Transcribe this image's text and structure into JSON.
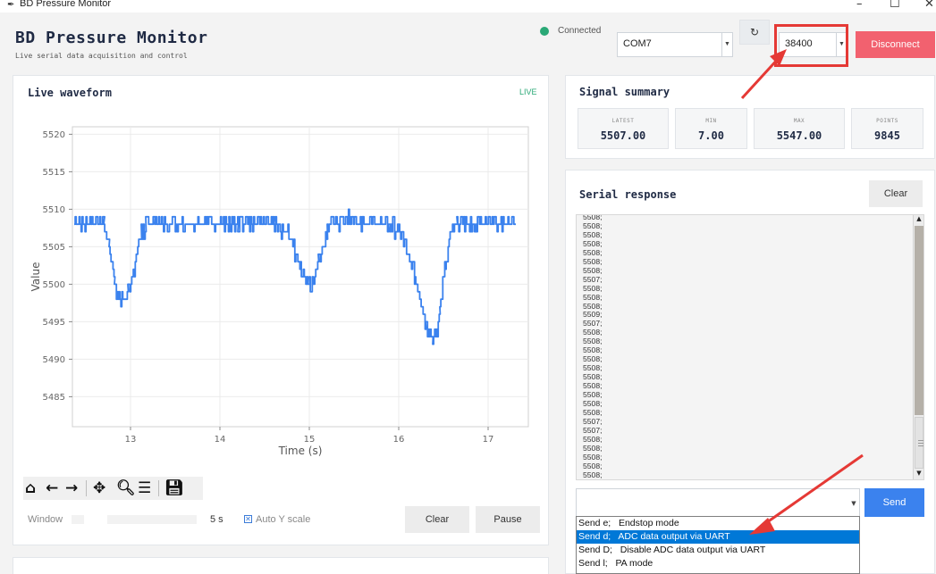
{
  "window": {
    "title": "BD Pressure Monitor",
    "controls": [
      "–",
      "☐",
      "✕"
    ]
  },
  "header": {
    "title": "BD Pressure Monitor",
    "subtitle": "Live serial data acquisition and control",
    "status": "Connected",
    "status_color": "#2aa876",
    "port": "COM7",
    "baud": "38400",
    "refresh_icon": "refresh-icon",
    "disconnect_label": "Disconnect"
  },
  "waveform": {
    "title": "Live waveform",
    "badge": "LIVE",
    "window_label": "Window",
    "window_value": "5 s",
    "auto_y_label": "Auto Y scale",
    "auto_y_checked": true,
    "clear_label": "Clear",
    "pause_label": "Pause",
    "toolbar_icons": [
      "home-icon",
      "back-arrow-icon",
      "forward-arrow-icon",
      "pan-icon",
      "zoom-icon",
      "configure-icon",
      "save-icon"
    ]
  },
  "chart_data": {
    "type": "line",
    "title": "",
    "xlabel": "Time (s)",
    "ylabel": "Value",
    "xlim": [
      12.35,
      17.45
    ],
    "ylim": [
      5481,
      5521
    ],
    "xticks": [
      13,
      14,
      15,
      16,
      17
    ],
    "yticks": [
      5485,
      5490,
      5495,
      5500,
      5505,
      5510,
      5515,
      5520
    ],
    "grid": true,
    "color": "#3b82ee",
    "series": [
      {
        "x": [
          12.37,
          12.7,
          12.76,
          12.82,
          12.87,
          12.92,
          12.97,
          13.02,
          13.07,
          13.12,
          13.17,
          13.22,
          13.27,
          14.1,
          14.2,
          14.3,
          14.6,
          14.75,
          14.85,
          14.9,
          14.95,
          15.0,
          15.05,
          15.1,
          15.15,
          15.2,
          15.25,
          15.3,
          15.35,
          15.45,
          15.6,
          15.9,
          16.0,
          16.1,
          16.18,
          16.24,
          16.3,
          16.34,
          16.38,
          16.42,
          16.46,
          16.52,
          16.58,
          16.65,
          17.3
        ],
        "y": [
          5508,
          5508,
          5505,
          5501,
          5497.5,
          5497.5,
          5499,
          5501,
          5504,
          5506.5,
          5508,
          5508,
          5508,
          5508,
          5508,
          5508,
          5508,
          5507,
          5504,
          5502,
          5500.5,
          5500,
          5501,
          5503,
          5505,
          5507,
          5508,
          5508,
          5508,
          5509,
          5508,
          5508,
          5507,
          5504,
          5501,
          5498,
          5495,
          5493,
          5492.5,
          5493.5,
          5497,
          5502,
          5507,
          5508,
          5508
        ]
      }
    ]
  },
  "summary": {
    "title": "Signal summary",
    "stats": [
      {
        "key": "LATEST",
        "value": "5507.00"
      },
      {
        "key": "MIN",
        "value": "7.00"
      },
      {
        "key": "MAX",
        "value": "5547.00"
      },
      {
        "key": "POINTS",
        "value": "9845"
      }
    ]
  },
  "serial": {
    "title": "Serial response",
    "clear_label": "Clear",
    "lines": [
      "5508;",
      "5508;",
      "5508;",
      "5508;",
      "5508;",
      "5508;",
      "5508;",
      "5507;",
      "5508;",
      "5508;",
      "5508;",
      "5509;",
      "5507;",
      "5508;",
      "5508;",
      "5508;",
      "5508;",
      "5508;",
      "5508;",
      "5508;",
      "5508;",
      "5508;",
      "5508;",
      "5507;",
      "5507;",
      "5508;",
      "5508;",
      "5508;",
      "5508;",
      "5508;",
      "5508;",
      "5507;"
    ],
    "send_label": "Send",
    "options": [
      "Send e;   Endstop mode",
      "Send d;   ADC data output via UART",
      "Send D;   Disable ADC data output via UART",
      "Send l;   PA mode"
    ],
    "selected_index": 1
  }
}
